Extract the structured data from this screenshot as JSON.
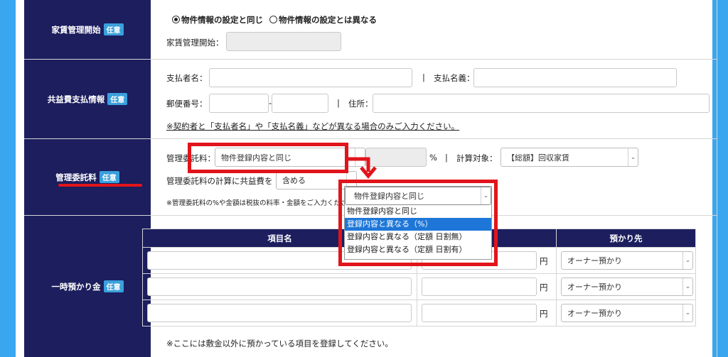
{
  "rows": {
    "rent": {
      "label": "家賃管理開始",
      "badge": "任意",
      "radio_same": "物件情報の設定と同じ",
      "radio_diff": "物件情報の設定とは異なる",
      "start_label": "家賃管理開始："
    },
    "common_fee": {
      "label": "共益費支払情報",
      "badge": "任意",
      "payer_label": "支払者名：",
      "sep": "|",
      "account_label": "支払名義：",
      "zip_label": "郵便番号：",
      "zip_dash": "-",
      "addr_label": "住所：",
      "note": "※契約者と「支払者名」や「支払名義」などが異なる場合のみご入力ください。"
    },
    "mgmt_fee": {
      "label": "管理委託料",
      "badge": "任意",
      "fee_label": "管理委託料：",
      "fee_select": "物件登録内容と同じ",
      "percent": "%",
      "sep": "|",
      "target_label": "計算対象：",
      "target_select": "【総額】回収家賃",
      "calc_label": "管理委託料の計算に共益費を",
      "calc_select": "含める",
      "note": "※管理委託料の%や金額は税抜の料率・金額をご入力ください。",
      "dropdown_current": "物件登録内容と同じ",
      "dropdown_options": [
        "物件登録内容と同じ",
        "登録内容と異なる（%）",
        "登録内容と異なる（定額 日割無）",
        "登録内容と異なる（定額 日割有）"
      ]
    },
    "deposit": {
      "label": "一時預かり金",
      "badge": "任意",
      "col_item": "項目名",
      "col_holder": "預かり先",
      "yen": "円",
      "holder_value": "オーナー預かり",
      "note": "※ここには敷金以外に預かっている項目を登録してください。"
    }
  },
  "colors": {
    "header_navy": "#1c1e5e",
    "badge_blue": "#3aa0dc",
    "highlight_red": "#e2141b",
    "selected_blue": "#1e77d8"
  }
}
